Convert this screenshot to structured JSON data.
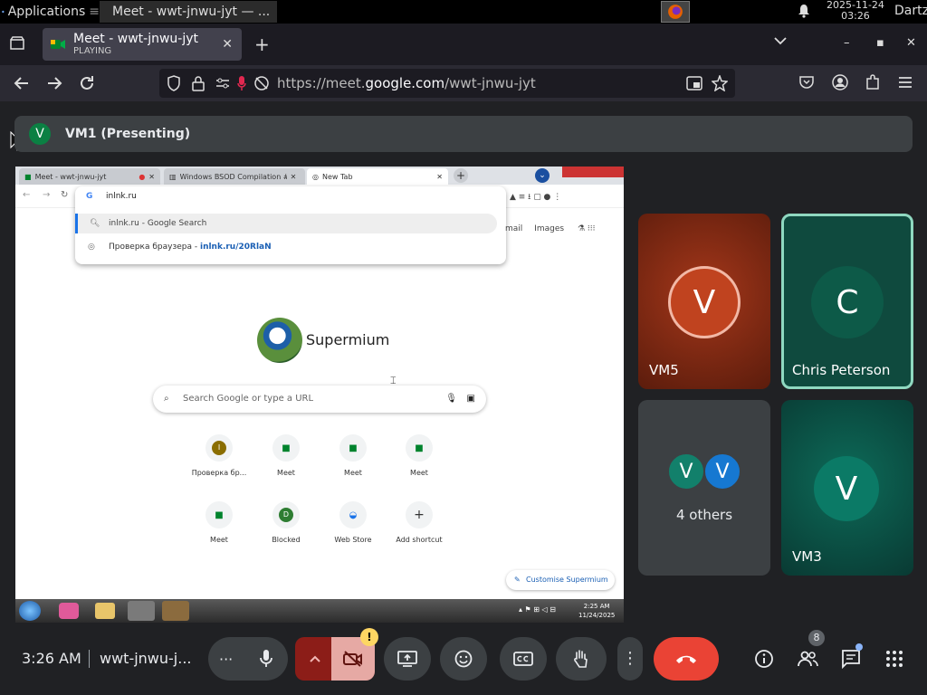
{
  "taskbar": {
    "apps_label": "Applications",
    "window_title": "Meet - wwt-jnwu-jyt — ...",
    "date": "2025-11-24",
    "time": "03:26",
    "user": "Dartz"
  },
  "browser": {
    "tab": {
      "title": "Meet - wwt-jnwu-jyt",
      "status": "PLAYING"
    },
    "url_prefix": "https://meet.",
    "url_domain": "google.com",
    "url_path": "/wwt-jnwu-jyt"
  },
  "meet": {
    "presenting_avatar": "V",
    "presenting_label": "VM1 (Presenting)",
    "tiles": [
      {
        "name": "VM5",
        "initial": "V",
        "bg": "#8a2c14",
        "circle": "#c0431f"
      },
      {
        "name": "Chris Peterson",
        "initial": "C",
        "bg": "#0f4a3e",
        "circle": "#0d5a48"
      },
      {
        "name": "4 others",
        "initial_a": "V",
        "initial_b": "V"
      },
      {
        "name": "VM3",
        "initial": "V",
        "bg": "#0b4d42",
        "circle": "#0b7a66"
      }
    ],
    "bottom": {
      "time": "3:26 AM",
      "code": "wwt-jnwu-j...",
      "people_count": "8",
      "camera_warning": "!"
    }
  },
  "shared_screen": {
    "tabs": [
      "Meet - wwt-jnwu-jyt",
      "Windows BSOD Compilation #4",
      "New Tab"
    ],
    "omnibox_query": "inlnk.ru",
    "suggestion_1": "inlnk.ru - Google Search",
    "suggestion_2_text": "Проверка браузера - ",
    "suggestion_2_link": "inlnk.ru/20RlaN",
    "top_links": [
      "mail",
      "Images"
    ],
    "brand": "Supermium",
    "search_placeholder": "Search Google or type a URL",
    "shortcuts": [
      {
        "label": "Проверка бр...",
        "icon": "I"
      },
      {
        "label": "Meet",
        "icon": "meet"
      },
      {
        "label": "Meet",
        "icon": "meet"
      },
      {
        "label": "Meet",
        "icon": "meet"
      },
      {
        "label": "Meet",
        "icon": "meet"
      },
      {
        "label": "Blocked",
        "icon": "D"
      },
      {
        "label": "Web Store",
        "icon": "store"
      },
      {
        "label": "Add shortcut",
        "icon": "+"
      }
    ],
    "customise": "Customise Supermium",
    "win_time": "2:25 AM",
    "win_date": "11/24/2025"
  }
}
